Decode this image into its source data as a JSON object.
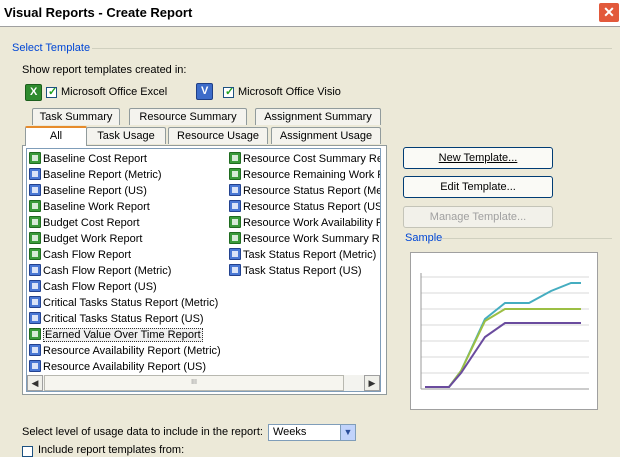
{
  "window": {
    "title": "Visual Reports - Create Report",
    "close_glyph": "✕"
  },
  "select_template": {
    "group_label": "Select Template",
    "show_label": "Show report templates created in:",
    "excel_label": "Microsoft Office Excel",
    "excel_checked": true,
    "visio_label": "Microsoft Office Visio",
    "visio_checked": true
  },
  "tabs": {
    "row_back": [
      "Task Summary",
      "Resource Summary",
      "Assignment Summary"
    ],
    "row_front": [
      "All",
      "Task Usage",
      "Resource Usage",
      "Assignment Usage"
    ],
    "active": "All"
  },
  "templates": {
    "column1": [
      {
        "label": "Baseline Cost Report",
        "icon": "excel-report-icon"
      },
      {
        "label": "Baseline Report (Metric)",
        "icon": "visio-report-icon"
      },
      {
        "label": "Baseline Report (US)",
        "icon": "visio-report-icon"
      },
      {
        "label": "Baseline Work Report",
        "icon": "excel-report-icon"
      },
      {
        "label": "Budget Cost Report",
        "icon": "excel-report-icon"
      },
      {
        "label": "Budget Work Report",
        "icon": "excel-report-icon"
      },
      {
        "label": "Cash Flow Report",
        "icon": "excel-report-icon"
      },
      {
        "label": "Cash Flow Report (Metric)",
        "icon": "visio-report-icon"
      },
      {
        "label": "Cash Flow Report (US)",
        "icon": "visio-report-icon"
      },
      {
        "label": "Critical Tasks Status Report (Metric)",
        "icon": "visio-report-icon"
      },
      {
        "label": "Critical Tasks Status Report (US)",
        "icon": "visio-report-icon"
      },
      {
        "label": "Earned Value Over Time Report",
        "icon": "excel-report-icon"
      },
      {
        "label": "Resource Availability Report (Metric)",
        "icon": "visio-report-icon"
      },
      {
        "label": "Resource Availability Report (US)",
        "icon": "visio-report-icon"
      }
    ],
    "column2": [
      {
        "label": "Resource Cost Summary Report",
        "icon": "excel-report-icon"
      },
      {
        "label": "Resource Remaining Work Report",
        "icon": "excel-report-icon"
      },
      {
        "label": "Resource Status Report (Metric)",
        "icon": "visio-report-icon"
      },
      {
        "label": "Resource Status Report (US)",
        "icon": "visio-report-icon"
      },
      {
        "label": "Resource Work Availability Report",
        "icon": "excel-report-icon"
      },
      {
        "label": "Resource Work Summary Report",
        "icon": "excel-report-icon"
      },
      {
        "label": "Task Status Report (Metric)",
        "icon": "visio-report-icon"
      },
      {
        "label": "Task Status Report (US)",
        "icon": "visio-report-icon"
      }
    ],
    "selected": "Earned Value Over Time Report"
  },
  "scrollbar": {
    "left_arrow": "◀",
    "right_arrow": "▶",
    "grip": "III"
  },
  "buttons": {
    "new_template": "New Template...",
    "edit_template": "Edit Template...",
    "manage_template": "Manage Template...",
    "manage_enabled": false
  },
  "sample": {
    "label": "Sample"
  },
  "usage": {
    "label": "Select level of usage data to include in the report:",
    "value": "Weeks",
    "arrow": "▼"
  },
  "include": {
    "label": "Include report templates from:",
    "checked": false
  },
  "colors": {
    "accent": "#0046d5",
    "tab_highlight": "#e68b2c",
    "close": "#e2593b"
  }
}
